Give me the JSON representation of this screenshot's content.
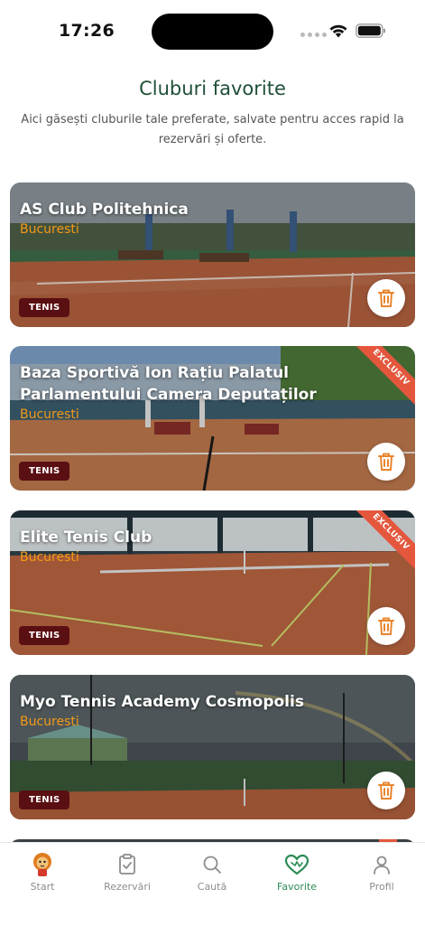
{
  "status_bar": {
    "time": "17:26"
  },
  "page": {
    "title": "Cluburi favorite",
    "subtitle": "Aici găsești cluburile tale preferate, salvate pentru acces rapid la rezervări și oferte."
  },
  "clubs": [
    {
      "name": "AS Club Politehnica",
      "city": "Bucuresti",
      "sport": "TENIS",
      "exclusive": false
    },
    {
      "name": "Baza Sportivă Ion Rațiu Palatul Parlamentului Camera Deputaților",
      "city": "Bucuresti",
      "sport": "TENIS",
      "exclusive": true,
      "exclusive_label": "EXCLUSIV"
    },
    {
      "name": "Elite Tenis Club",
      "city": "Bucuresti",
      "sport": "TENIS",
      "exclusive": true,
      "exclusive_label": "EXCLUSIV"
    },
    {
      "name": "Myo Tennis Academy Cosmopolis",
      "city": "Bucuresti",
      "sport": "TENIS",
      "exclusive": false
    }
  ],
  "tab_bar": {
    "items": [
      {
        "label": "Start",
        "icon": "lion-mascot-icon"
      },
      {
        "label": "Rezervări",
        "icon": "clipboard-check-icon"
      },
      {
        "label": "Caută",
        "icon": "search-icon"
      },
      {
        "label": "Favorite",
        "icon": "heart-icon",
        "active": true
      },
      {
        "label": "Profil",
        "icon": "user-icon"
      }
    ]
  },
  "colors": {
    "brand_green": "#1f4f37",
    "active_tab": "#2c8b55",
    "city_orange": "#f39a16",
    "badge_maroon": "#5a0f12",
    "ribbon_red": "#e4573d"
  }
}
